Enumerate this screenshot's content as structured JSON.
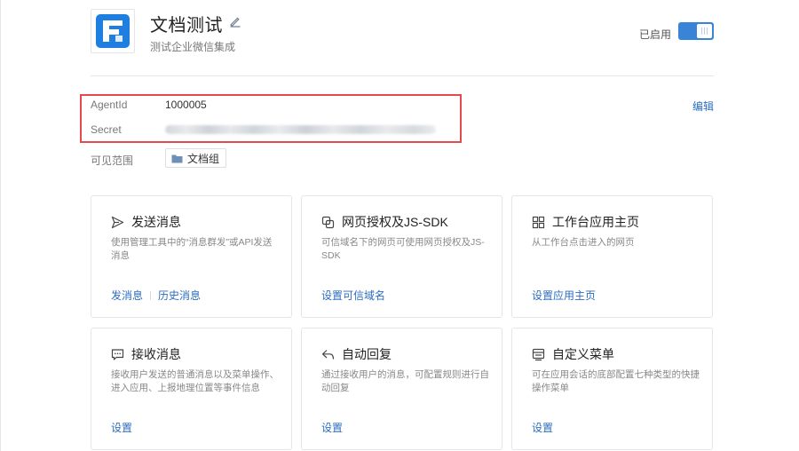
{
  "header": {
    "title": "文档测试",
    "description": "测试企业微信集成",
    "status_label": "已启用"
  },
  "info": {
    "agentid_label": "AgentId",
    "agentid_value": "1000005",
    "secret_label": "Secret",
    "scope_label": "可见范围",
    "scope_tag": "文档组",
    "edit_label": "编辑"
  },
  "cards": [
    {
      "title": "发送消息",
      "desc": "使用管理工具中的“消息群发”或API发送消息",
      "links": [
        "发消息",
        "历史消息"
      ],
      "icon": "send-icon"
    },
    {
      "title": "网页授权及JS-SDK",
      "desc": "可信域名下的网页可使用网页授权及JS-SDK",
      "links": [
        "设置可信域名"
      ],
      "icon": "web-auth-icon"
    },
    {
      "title": "工作台应用主页",
      "desc": "从工作台点击进入的网页",
      "links": [
        "设置应用主页"
      ],
      "icon": "grid-icon"
    },
    {
      "title": "接收消息",
      "desc": "接收用户发送的普通消息以及菜单操作、进入应用、上报地理位置等事件信息",
      "links": [
        "设置"
      ],
      "icon": "chat-icon"
    },
    {
      "title": "自动回复",
      "desc": "通过接收用户的消息，可配置规则进行自动回复",
      "links": [
        "设置"
      ],
      "icon": "reply-icon"
    },
    {
      "title": "自定义菜单",
      "desc": "可在应用会话的底部配置七种类型的快捷操作菜单",
      "links": [
        "设置"
      ],
      "icon": "menu-icon"
    }
  ],
  "colors": {
    "accent": "#2c6dbf",
    "toggle": "#3a84d8",
    "highlight": "#e24a4f"
  }
}
